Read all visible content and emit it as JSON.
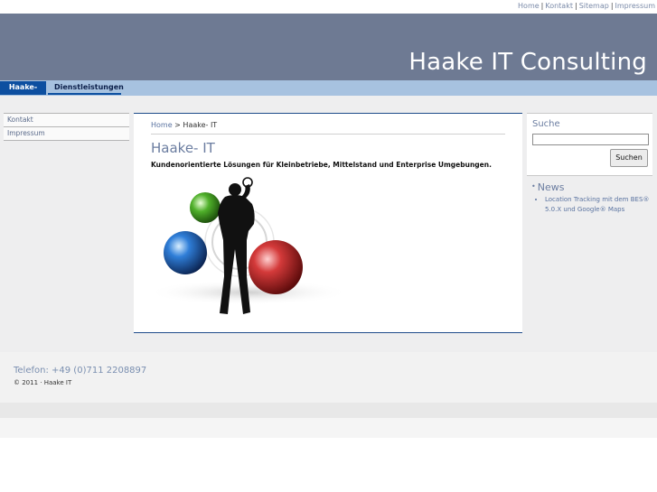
{
  "toplinks": {
    "home": "Home",
    "kontakt": "Kontakt",
    "sitemap": "Sitemap",
    "impressum": "Impressum",
    "separator": "|"
  },
  "banner": {
    "brand": "Haake IT Consulting"
  },
  "nav": {
    "tabs": [
      {
        "label": "Haake- IT"
      },
      {
        "label": "Dienstleistungen"
      }
    ]
  },
  "leftmenu": {
    "items": [
      {
        "label": "Kontakt"
      },
      {
        "label": "Impressum"
      }
    ]
  },
  "content": {
    "breadcrumb_home": "Home",
    "breadcrumb_sep": ">",
    "breadcrumb_current": "Haake- IT",
    "title": "Haake- IT",
    "lead": "Kundenorientierte Lösungen für Kleinbetriebe, Mittelstand und Enterprise Umgebungen."
  },
  "search": {
    "label": "Suche",
    "value": "",
    "button": "Suchen"
  },
  "news": {
    "heading": "News",
    "bullet": "•",
    "items": [
      {
        "text": "Location Tracking mit dem BES® 5.0.X und Google® Maps"
      }
    ]
  },
  "footer": {
    "phone": "Telefon: +49 (0)711 2208897",
    "copyright": "© 2011 · Haake IT"
  },
  "colors": {
    "banner": "#6e7a93",
    "nav": "#a7c2e0",
    "nav_active": "#0d4fa0",
    "accent_text": "#6b7da0"
  }
}
